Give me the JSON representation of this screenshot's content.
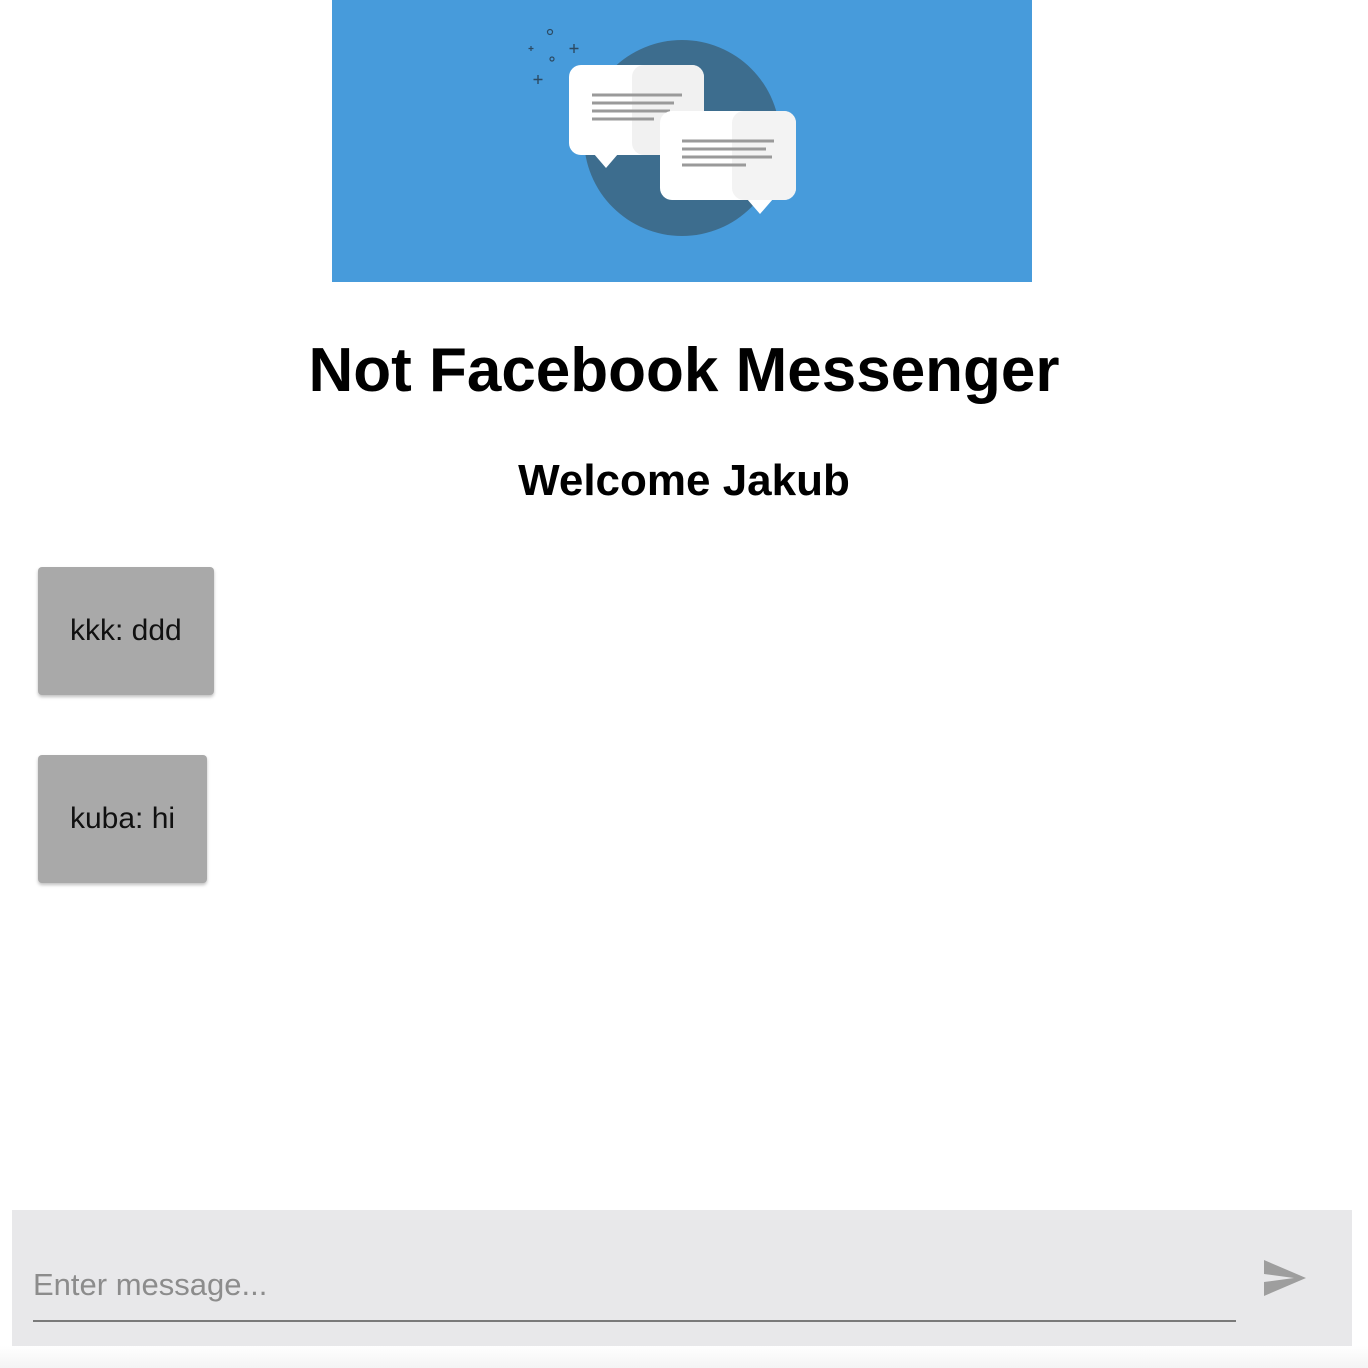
{
  "header": {
    "title": "Not Facebook Messenger",
    "welcome": "Welcome Jakub",
    "banner_icon": "chat-bubbles-illustration",
    "banner_color": "#479bdb"
  },
  "messages": [
    {
      "text": "kkk: ddd"
    },
    {
      "text": "kuba: hi"
    }
  ],
  "composer": {
    "placeholder": "Enter message...",
    "value": "",
    "send_icon": "send-icon"
  },
  "colors": {
    "message_bubble": "#a9a9a9",
    "composer_background": "#e8e8ea"
  }
}
